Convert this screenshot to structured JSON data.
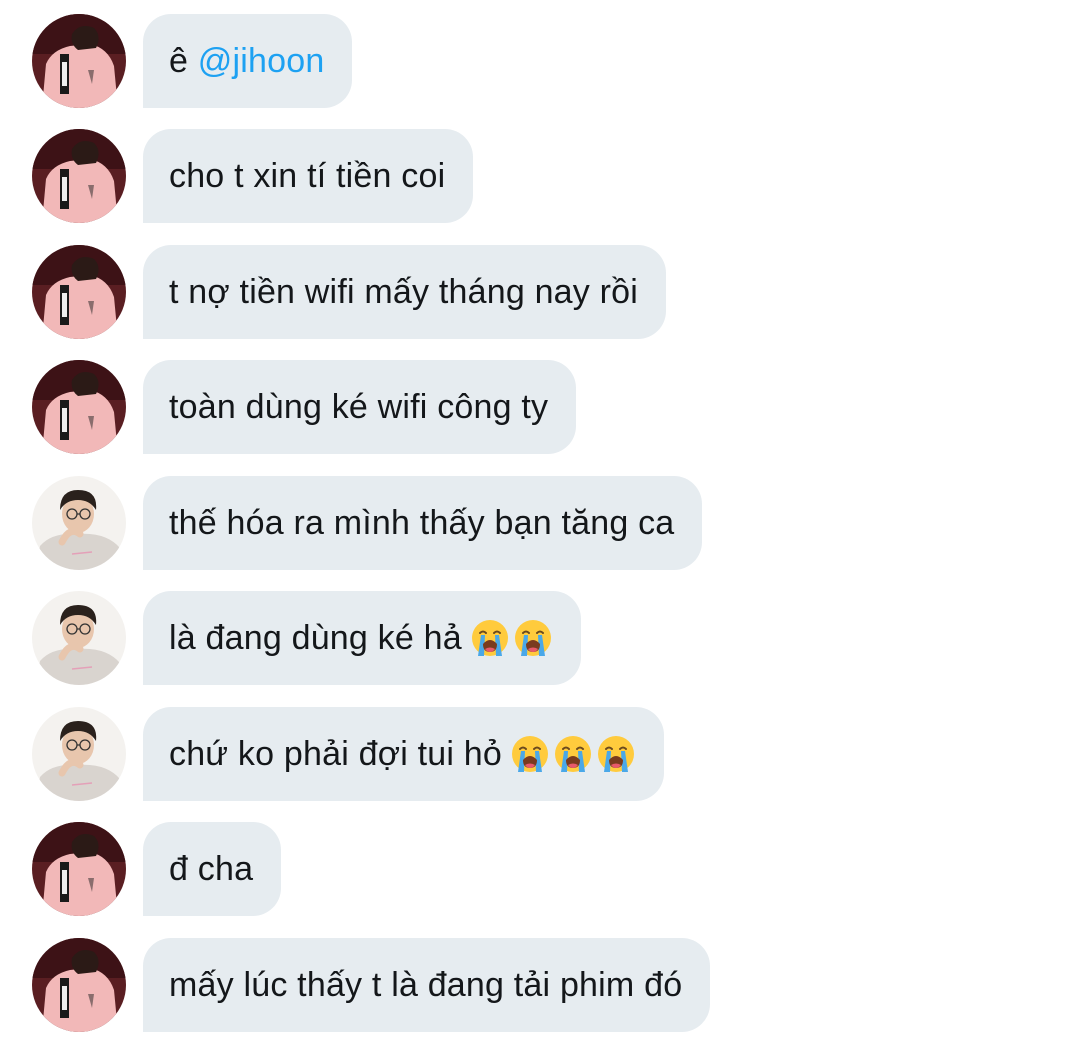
{
  "colors": {
    "bubble_bg": "#e6ecf0",
    "text": "#14171a",
    "mention": "#1da1f2",
    "page_bg": "#ffffff"
  },
  "messages": [
    {
      "sender": "avatar-pink-jacket",
      "text": "ê ",
      "mention": "@jihoon",
      "emojis": []
    },
    {
      "sender": "avatar-pink-jacket",
      "text": "cho t xin tí tiền coi",
      "emojis": []
    },
    {
      "sender": "avatar-pink-jacket",
      "text": "t nợ tiền wifi mấy tháng nay rồi",
      "emojis": []
    },
    {
      "sender": "avatar-pink-jacket",
      "text": "toàn dùng ké wifi công ty",
      "emojis": []
    },
    {
      "sender": "avatar-glasses-hoodie",
      "text": "thế hóa ra mình thấy bạn tăng ca",
      "emojis": []
    },
    {
      "sender": "avatar-glasses-hoodie",
      "text": "là đang dùng ké hả",
      "emojis": [
        "loudly-crying-face",
        "loudly-crying-face"
      ]
    },
    {
      "sender": "avatar-glasses-hoodie",
      "text": "chứ ko phải đợi tui hỏ",
      "emojis": [
        "loudly-crying-face",
        "loudly-crying-face",
        "loudly-crying-face"
      ]
    },
    {
      "sender": "avatar-pink-jacket",
      "text": "đ cha",
      "emojis": []
    },
    {
      "sender": "avatar-pink-jacket",
      "text": "mấy lúc thấy t là đang tải phim đó",
      "emojis": []
    }
  ]
}
